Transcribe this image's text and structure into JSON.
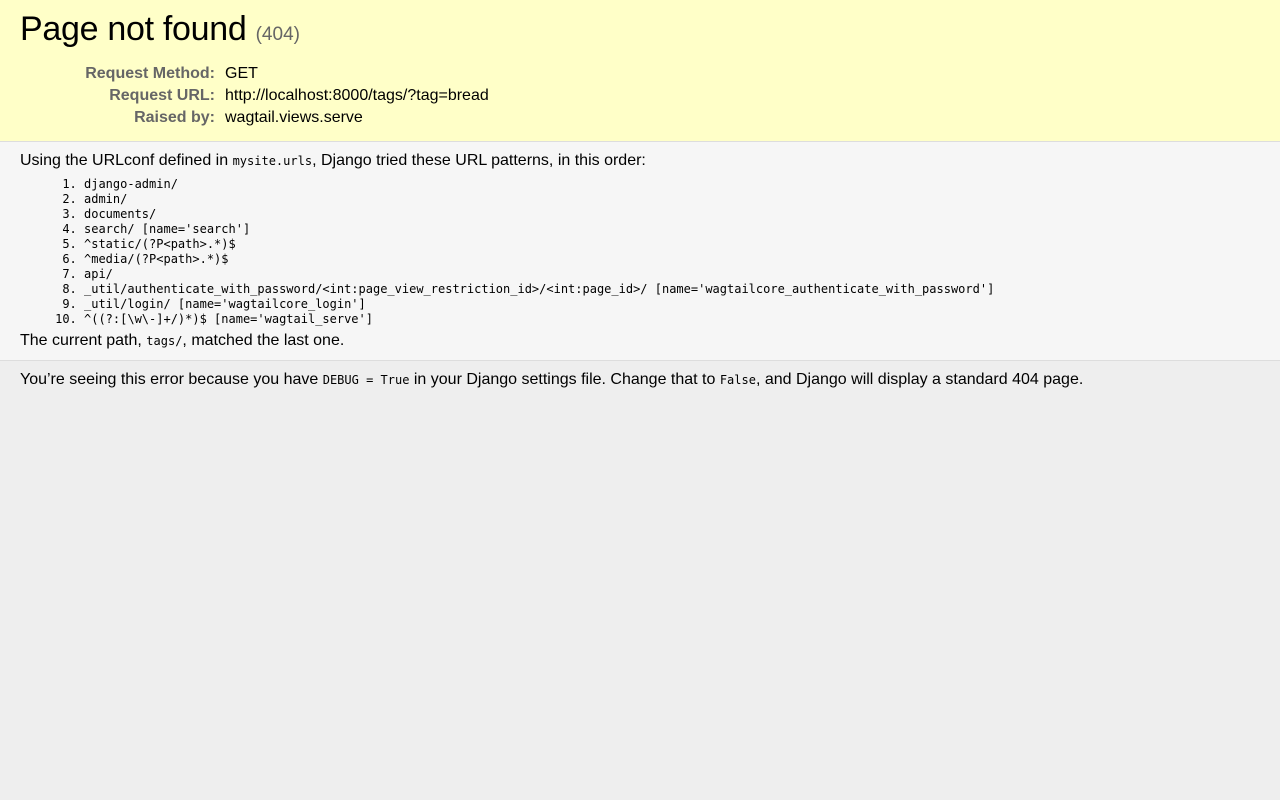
{
  "summary": {
    "title": "Page not found",
    "status_code": "(404)",
    "meta": [
      {
        "label": "Request Method:",
        "value": "GET"
      },
      {
        "label": "Request URL:",
        "value": "http://localhost:8000/tags/?tag=bread"
      },
      {
        "label": "Raised by:",
        "value": "wagtail.views.serve"
      }
    ]
  },
  "info": {
    "intro_before": "Using the URLconf defined in ",
    "urlconf": "mysite.urls",
    "intro_after": ", Django tried these URL patterns, in this order:",
    "patterns": [
      "django-admin/",
      "admin/",
      "documents/",
      "search/ [name='search']",
      "^static/(?P<path>.*)$",
      "^media/(?P<path>.*)$",
      "api/",
      "_util/authenticate_with_password/<int:page_view_restriction_id>/<int:page_id>/ [name='wagtailcore_authenticate_with_password']",
      "_util/login/ [name='wagtailcore_login']",
      "^((?:[\\w\\-]+/)*)$ [name='wagtail_serve']"
    ],
    "current_before": "The current path, ",
    "current_path": "tags/",
    "current_after": ", matched the last one."
  },
  "explanation": {
    "text_before": "You’re seeing this error because you have ",
    "debug_setting": "DEBUG = True",
    "text_middle": " in your Django settings file. Change that to ",
    "false_value": "False",
    "text_after": ", and Django will display a standard 404 page."
  }
}
